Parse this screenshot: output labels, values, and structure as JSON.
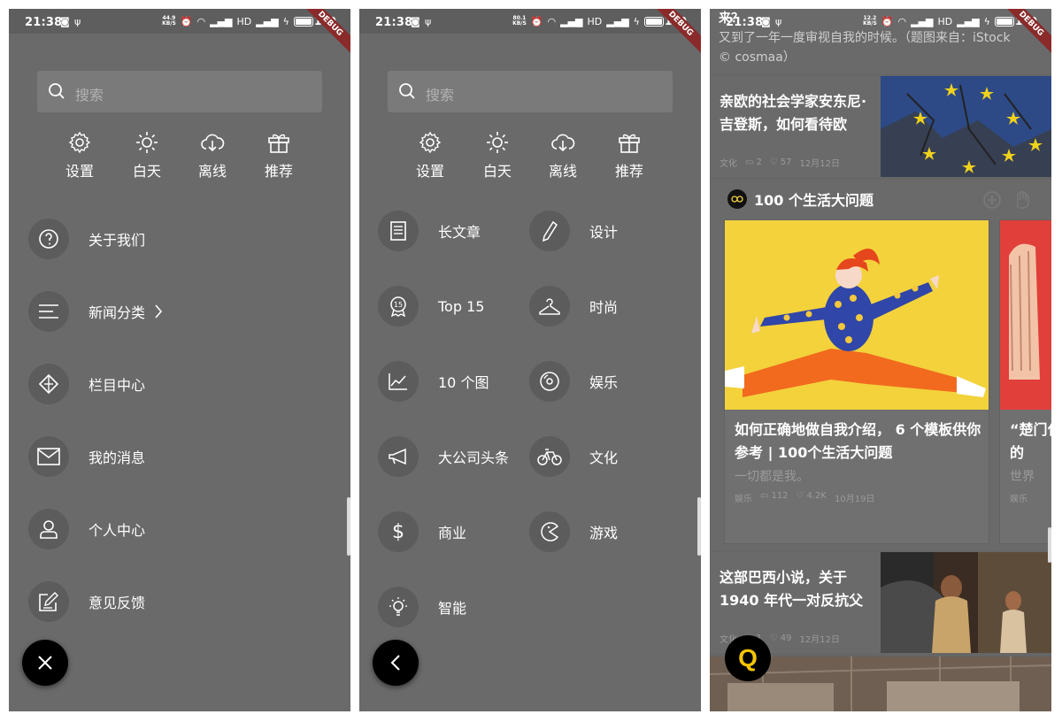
{
  "status": {
    "time": "21:38",
    "battery": "100",
    "debug": "DEBUG",
    "net_speed": [
      "44.9\nKB/S",
      "80.1\nKB/S",
      "12.2\nKB/S"
    ]
  },
  "panel1": {
    "search_placeholder": "搜索",
    "quick": [
      {
        "label": "设置",
        "icon": "gear-icon"
      },
      {
        "label": "白天",
        "icon": "sun-icon"
      },
      {
        "label": "离线",
        "icon": "cloud-download-icon"
      },
      {
        "label": "推荐",
        "icon": "gift-icon"
      }
    ],
    "menu": [
      {
        "label": "关于我们",
        "icon": "question-icon"
      },
      {
        "label": "新闻分类",
        "icon": "list-icon",
        "chevron": true
      },
      {
        "label": "栏目中心",
        "icon": "diamond-icon"
      },
      {
        "label": "我的消息",
        "icon": "mail-icon"
      },
      {
        "label": "个人中心",
        "icon": "user-icon"
      },
      {
        "label": "意见反馈",
        "icon": "edit-icon"
      }
    ],
    "fab_icon": "close-icon"
  },
  "panel2": {
    "search_placeholder": "搜索",
    "quick": [
      {
        "label": "设置"
      },
      {
        "label": "白天"
      },
      {
        "label": "离线"
      },
      {
        "label": "推荐"
      }
    ],
    "categories": [
      {
        "label": "长文章",
        "icon": "document-icon"
      },
      {
        "label": "设计",
        "icon": "pencil-icon"
      },
      {
        "label": "Top 15",
        "icon": "badge-icon"
      },
      {
        "label": "时尚",
        "icon": "hanger-icon"
      },
      {
        "label": "10 个图",
        "icon": "line-chart-icon"
      },
      {
        "label": "娱乐",
        "icon": "disc-icon"
      },
      {
        "label": "大公司头条",
        "icon": "megaphone-icon"
      },
      {
        "label": "文化",
        "icon": "bicycle-icon"
      },
      {
        "label": "商业",
        "icon": "dollar-icon"
      },
      {
        "label": "游戏",
        "icon": "pacman-icon"
      },
      {
        "label": "智能",
        "icon": "bulb-icon"
      }
    ],
    "fab_icon": "back-icon"
  },
  "panel3": {
    "top_text_1": "来？",
    "top_text_2": "又到了一年一度审视自我的时候。（题图来自：iStock",
    "top_text_3": "© cosmaa）",
    "article1": {
      "title": "亲欧的社会学家安东尼·吉登斯，如何看待欧",
      "category": "文化",
      "comments": "2",
      "likes": "57",
      "date": "12月12日"
    },
    "topic": {
      "title": "100 个生活大问题",
      "card": {
        "title": "如何正确地做自我介绍， 6 个模板供你参考 | 100个生活大问题",
        "subtitle": "一切都是我。",
        "category": "娱乐",
        "comments": "112",
        "likes": "4.2K",
        "date": "10月19日"
      },
      "card2": {
        "title": "“楚门化的",
        "subtitle": "世界",
        "category": "娱乐"
      }
    },
    "article2": {
      "title": "这部巴西小说，关于 1940 年代一对反抗父",
      "category": "文化",
      "comments": "1",
      "likes": "49",
      "date": "12月12日"
    },
    "fab_letter": "Q"
  }
}
